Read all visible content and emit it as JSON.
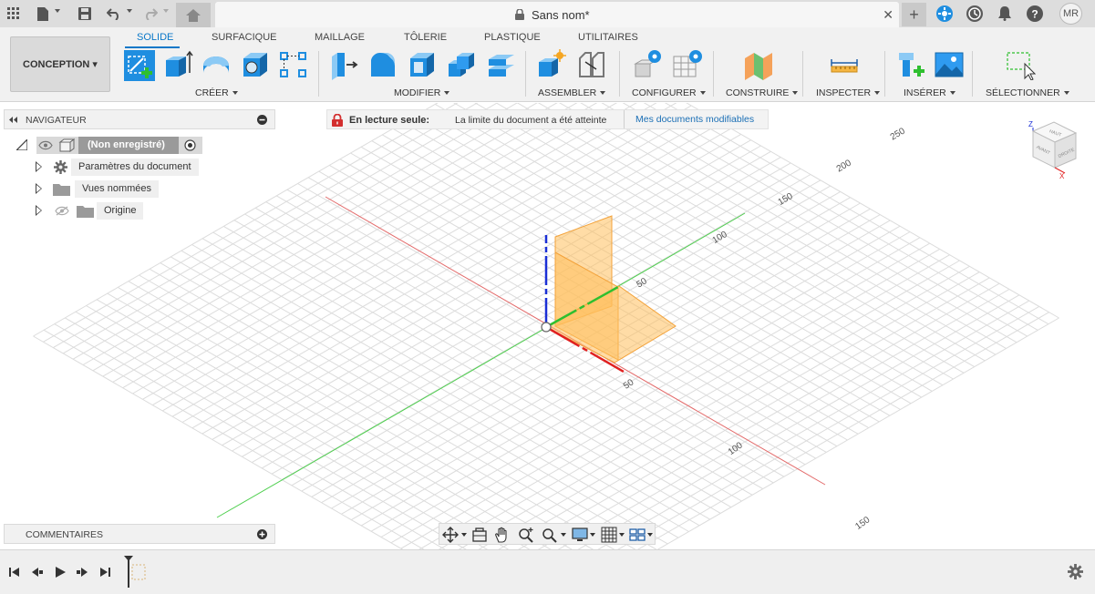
{
  "topbar": {
    "doc_title": "Sans nom*",
    "close_tab": "✕",
    "new_tab": "+",
    "user_initials": "MR"
  },
  "ribbon": {
    "workspace": "CONCEPTION ▾",
    "tabs": [
      {
        "label": "SOLIDE",
        "active": true
      },
      {
        "label": "SURFACIQUE"
      },
      {
        "label": "MAILLAGE"
      },
      {
        "label": "TÔLERIE"
      },
      {
        "label": "PLASTIQUE"
      },
      {
        "label": "UTILITAIRES"
      }
    ],
    "groups": {
      "creer": "CRÉER",
      "modifier": "MODIFIER",
      "assembler": "ASSEMBLER",
      "configurer": "CONFIGURER",
      "construire": "CONSTRUIRE",
      "inspecter": "INSPECTER",
      "inserer": "INSÉRER",
      "selectionner": "SÉLECTIONNER"
    }
  },
  "navigator": {
    "title": "NAVIGATEUR",
    "root_label": "(Non enregistré)",
    "items": [
      {
        "label": "Paramètres du document"
      },
      {
        "label": "Vues nommées"
      },
      {
        "label": "Origine"
      }
    ]
  },
  "banner": {
    "title": "En lecture seule:",
    "message": "La limite du document a été atteinte",
    "link": "Mes documents modifiables"
  },
  "comments": {
    "title": "COMMENTAIRES"
  },
  "viewport": {
    "ruler_labels_right": [
      "50",
      "100",
      "150",
      "200",
      "250"
    ],
    "ruler_labels_front": [
      "50",
      "100",
      "150"
    ]
  },
  "viewcube": {
    "axis_z": "Z",
    "axis_x": "X",
    "face_top": "HAUT",
    "face_front": "AVANT",
    "face_right": "DROITE"
  },
  "colors": {
    "accent": "#0b78c8",
    "x_axis": "#e02020",
    "y_axis": "#2fbf2f",
    "z_axis": "#1a2fd6",
    "plane": "#ffc060"
  }
}
